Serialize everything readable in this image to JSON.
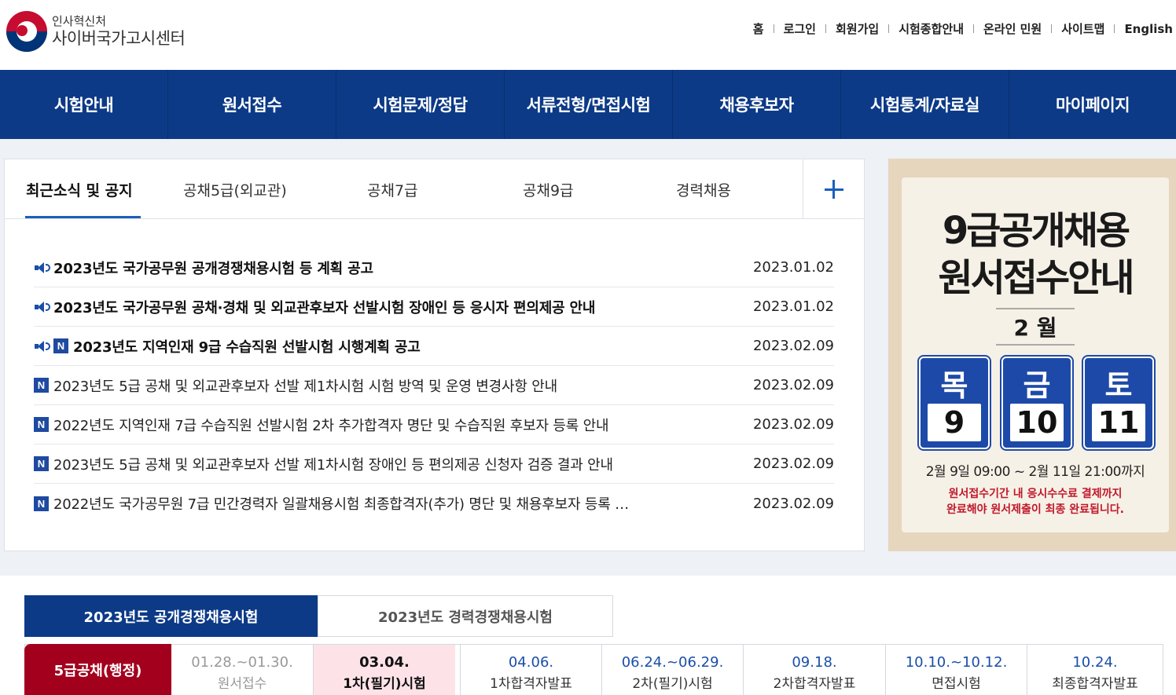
{
  "header": {
    "logo_sub": "인사혁신처",
    "logo_main": "사이버국가고시센터",
    "util_links": [
      "홈",
      "로그인",
      "회원가입",
      "시험종합안내",
      "온라인 민원",
      "사이트맵",
      "English"
    ]
  },
  "nav": [
    "시험안내",
    "원서접수",
    "시험문제/정답",
    "서류전형/면접시험",
    "채용후보자",
    "시험통계/자료실",
    "마이페이지"
  ],
  "notice": {
    "tabs": [
      "최근소식 및 공지",
      "공채5급(외교관)",
      "공채7급",
      "공채9급",
      "경력채용"
    ],
    "more_label": "+",
    "items": [
      {
        "title": "2023년도 국가공무원 공개경쟁채용시험 등 계획 공고",
        "date": "2023.01.02",
        "pinned": true,
        "new": false
      },
      {
        "title": "2023년도 국가공무원 공채·경채 및 외교관후보자 선발시험 장애인 등 응시자 편의제공 안내",
        "date": "2023.01.02",
        "pinned": true,
        "new": false
      },
      {
        "title": "2023년도 지역인재 9급 수습직원 선발시험 시행계획 공고",
        "date": "2023.02.09",
        "pinned": true,
        "new": true
      },
      {
        "title": "2023년도 5급 공채 및 외교관후보자 선발 제1차시험 시험 방역 및 운영 변경사항 안내",
        "date": "2023.02.09",
        "pinned": false,
        "new": true
      },
      {
        "title": "2022년도 지역인재 7급 수습직원 선발시험 2차 추가합격자 명단 및 수습직원 후보자 등록 안내",
        "date": "2023.02.09",
        "pinned": false,
        "new": true
      },
      {
        "title": "2023년도 5급 공채 및 외교관후보자 선발 제1차시험 장애인 등 편의제공 신청자 검증 결과 안내",
        "date": "2023.02.09",
        "pinned": false,
        "new": true
      },
      {
        "title": "2022년도 국가공무원 7급 민간경력자 일괄채용시험 최종합격자(추가) 명단 및 채용후보자 등록 …",
        "date": "2023.02.09",
        "pinned": false,
        "new": true
      }
    ],
    "new_badge": "N"
  },
  "banner": {
    "title1": "9급공개채용",
    "title2": "원서접수안내",
    "month": "2 월",
    "days": [
      {
        "name": "목",
        "num": "9"
      },
      {
        "name": "금",
        "num": "10"
      },
      {
        "name": "토",
        "num": "11"
      }
    ],
    "range": "2월 9일 09:00 ~ 2월 11일 21:00까지",
    "note1": "원서접수기간 내 응시수수료 결제까지",
    "note2": "완료해야 원서제출이 최종 완료됩니다."
  },
  "exam_tabs": [
    "2023년도 공개경쟁채용시험",
    "2023년도 경력경쟁채용시험"
  ],
  "schedule": {
    "head": "5급공채(행정)",
    "steps": [
      {
        "date": "01.28.~01.30.",
        "label": "원서접수",
        "state": "past"
      },
      {
        "date": "03.04.",
        "label": "1차(필기)시험",
        "state": "current"
      },
      {
        "date": "04.06.",
        "label": "1차합격자발표",
        "state": "future"
      },
      {
        "date": "06.24.~06.29.",
        "label": "2차(필기)시험",
        "state": "future"
      },
      {
        "date": "09.18.",
        "label": "2차합격자발표",
        "state": "future"
      },
      {
        "date": "10.10.~10.12.",
        "label": "면접시험",
        "state": "future"
      },
      {
        "date": "10.24.",
        "label": "최종합격자발표",
        "state": "future"
      }
    ]
  }
}
